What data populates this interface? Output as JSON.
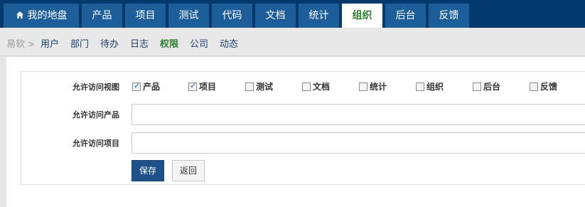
{
  "topnav": {
    "items": [
      {
        "label": "我的地盘",
        "icon": "home-icon"
      },
      {
        "label": "产品"
      },
      {
        "label": "项目"
      },
      {
        "label": "测试"
      },
      {
        "label": "代码"
      },
      {
        "label": "文档"
      },
      {
        "label": "统计"
      },
      {
        "label": "组织",
        "active": true
      },
      {
        "label": "后台"
      },
      {
        "label": "反馈"
      }
    ],
    "active_color": "#2e7d32",
    "background": "#03396c"
  },
  "subnav": {
    "breadcrumb": "易软",
    "links": [
      {
        "label": "用户"
      },
      {
        "label": "部门"
      },
      {
        "label": "待办"
      },
      {
        "label": "日志"
      },
      {
        "label": "权限",
        "active": true
      },
      {
        "label": "公司"
      },
      {
        "label": "动态"
      }
    ]
  },
  "form": {
    "views_label": "允许访问视图",
    "views": [
      {
        "label": "产品",
        "checked": true
      },
      {
        "label": "项目",
        "checked": true
      },
      {
        "label": "测试",
        "checked": false
      },
      {
        "label": "文档",
        "checked": false
      },
      {
        "label": "统计",
        "checked": false
      },
      {
        "label": "组织",
        "checked": false
      },
      {
        "label": "后台",
        "checked": false
      },
      {
        "label": "反馈",
        "checked": false
      }
    ],
    "products_label": "允许访问产品",
    "projects_label": "允许访问项目",
    "save_label": "保存",
    "back_label": "返回"
  }
}
